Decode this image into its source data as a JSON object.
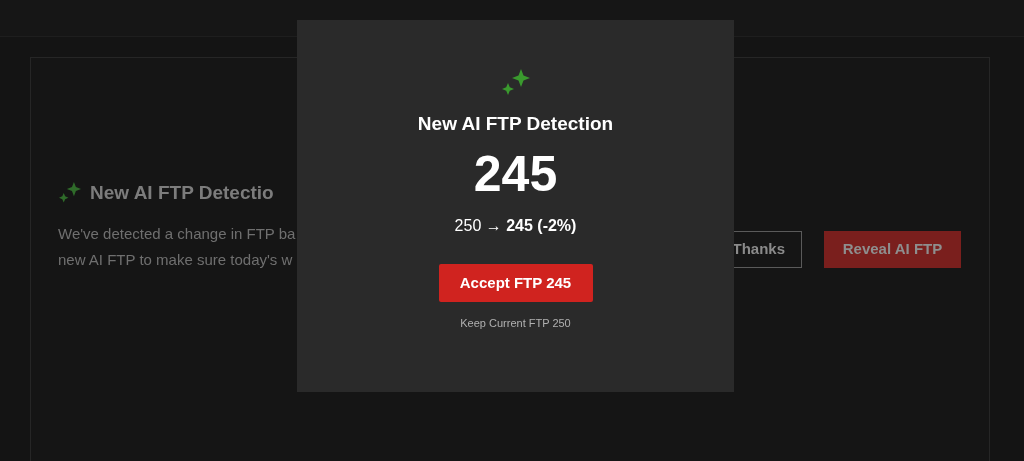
{
  "card": {
    "title": "New AI FTP Detectio",
    "description_lines": [
      "We've detected a change in FTP ba",
      "new AI FTP to make sure today's w"
    ],
    "buttons": [
      {
        "kind": "outline",
        "label": "Thanks"
      },
      {
        "kind": "primary",
        "label": "Reveal AI FTP"
      }
    ]
  },
  "modal": {
    "title": "New AI FTP Detection",
    "value": "245",
    "change": "250 → **245 (-2%)**",
    "accept_button": "Accept FTP 245",
    "keep_link": "Keep Current FTP 250"
  }
}
